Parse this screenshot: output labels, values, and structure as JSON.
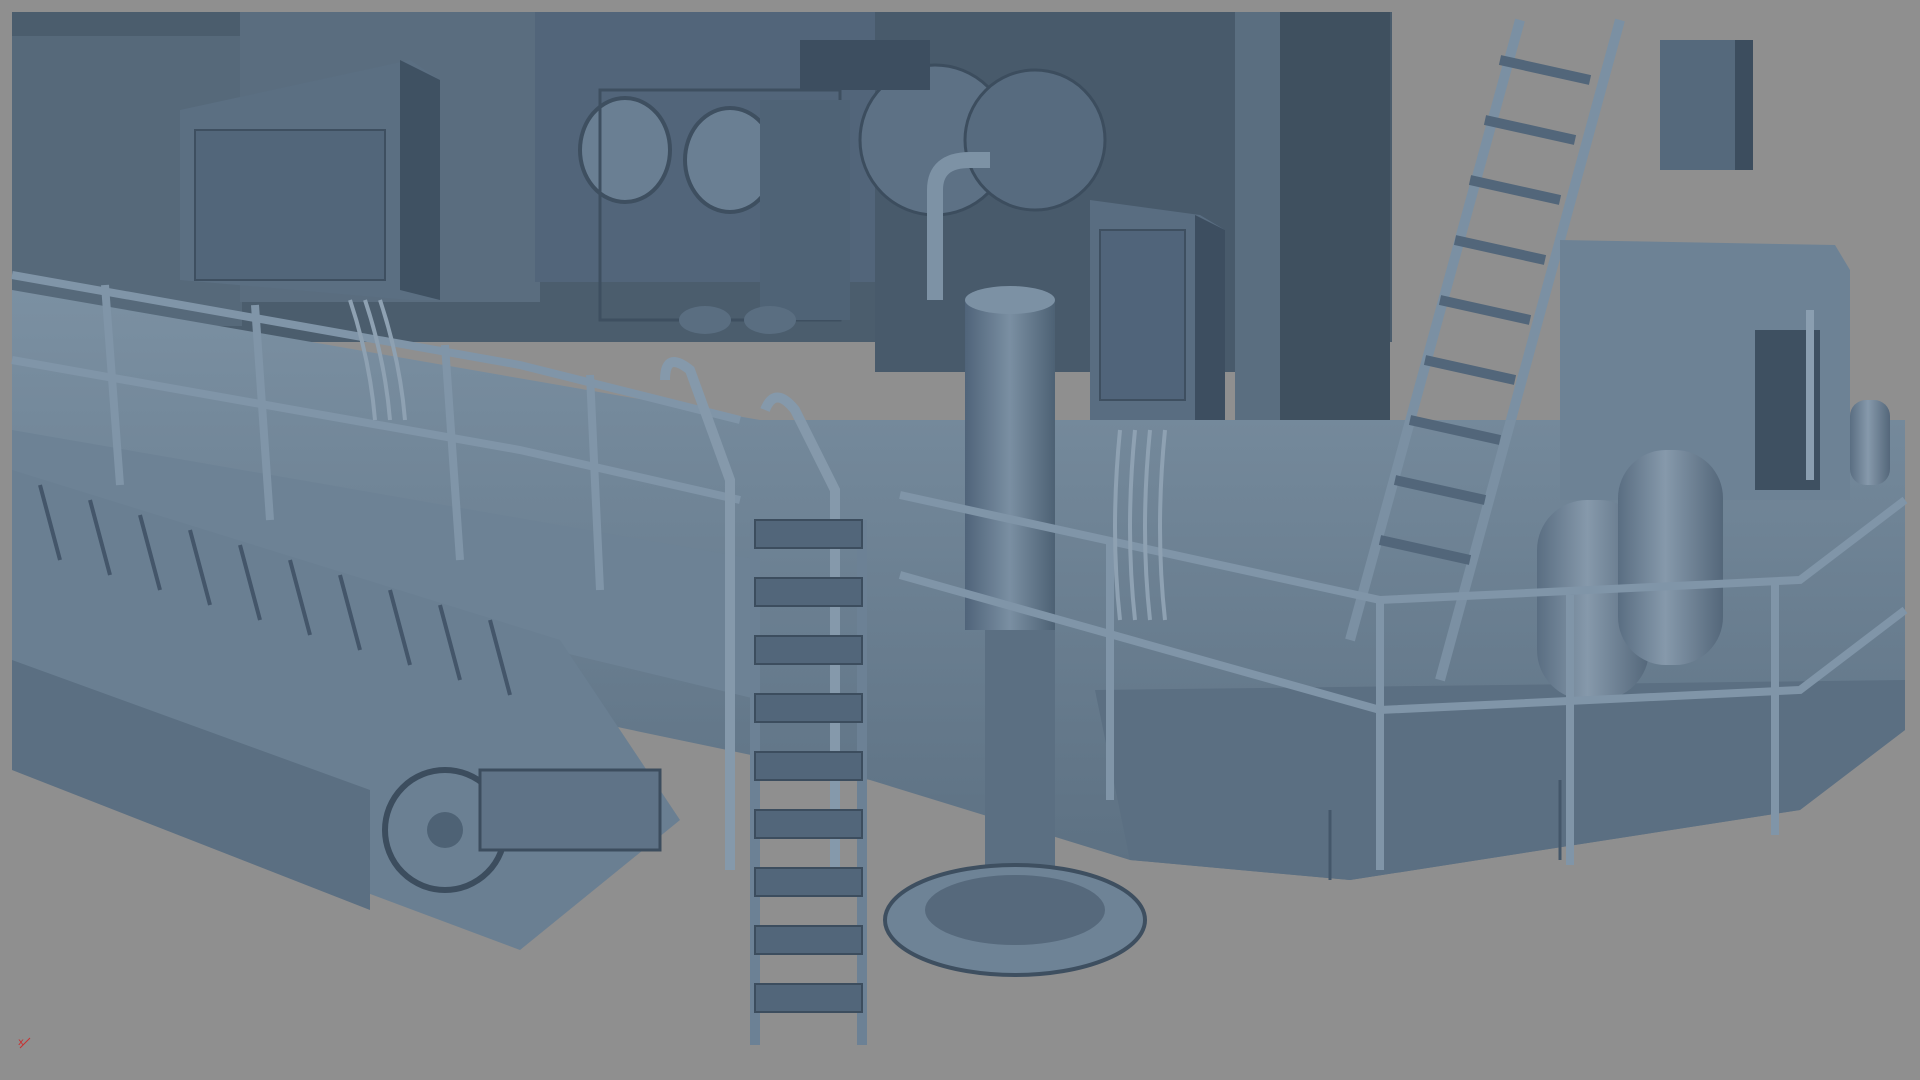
{
  "viewport": {
    "name": "3D Viewport",
    "background_color": "#8f8f8f",
    "model_color": "#6a7f91",
    "shade_dark": "#465868",
    "shade_mid": "#5a6e80",
    "shade_light": "#7d92a4",
    "axis_color": "#c83030",
    "axis_label": "x"
  },
  "scene": {
    "description_icons": [
      "control-cabinet-icon",
      "staircase-icon",
      "ladder-icon",
      "gas-cylinder-icon",
      "crawler-track-icon",
      "motor-icon",
      "vertical-tank-icon"
    ]
  }
}
